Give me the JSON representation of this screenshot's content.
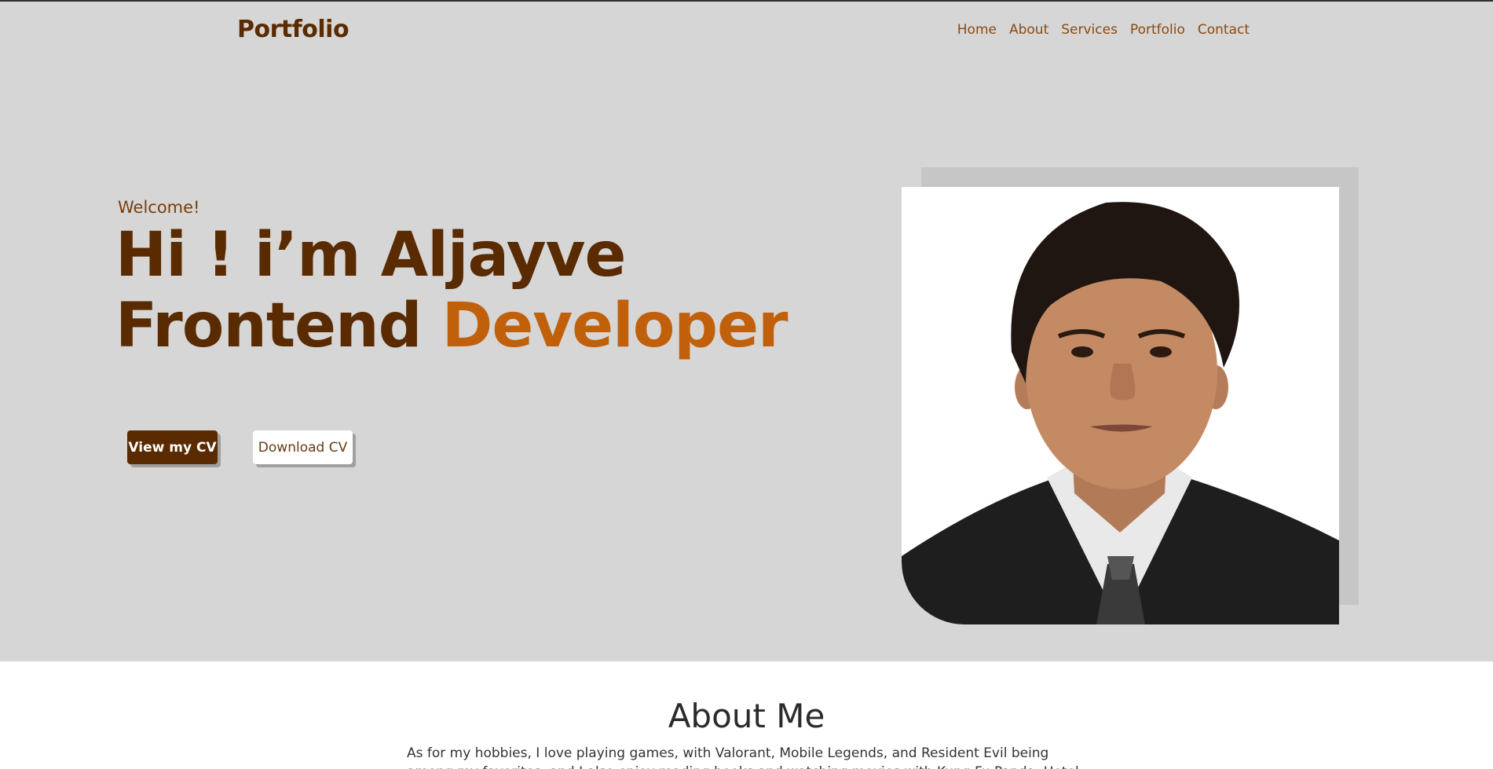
{
  "header": {
    "brand": "Portfolio",
    "nav": [
      "Home",
      "About",
      "Services",
      "Portfolio",
      "Contact"
    ]
  },
  "hero": {
    "welcome": "Welcome!",
    "line1": "Hi ! i’m Aljayve",
    "line2_main": "Frontend",
    "line2_accent": "Developer",
    "primary_button": "View my CV",
    "secondary_button": "Download CV",
    "photo_icon": "profile-photo-icon"
  },
  "about": {
    "title": "About Me",
    "text": "As for my hobbies, I love playing games, with Valorant, Mobile Legends, and Resident Evil being among my favorites, and I also enjoy reading books and watching movies with Kung Fu Panda, Hotel Transylvania. How"
  },
  "colors": {
    "hero_bg": "#d6d6d6",
    "brand": "#5a2a00",
    "accent": "#c1600a",
    "nav": "#8a4a12"
  }
}
